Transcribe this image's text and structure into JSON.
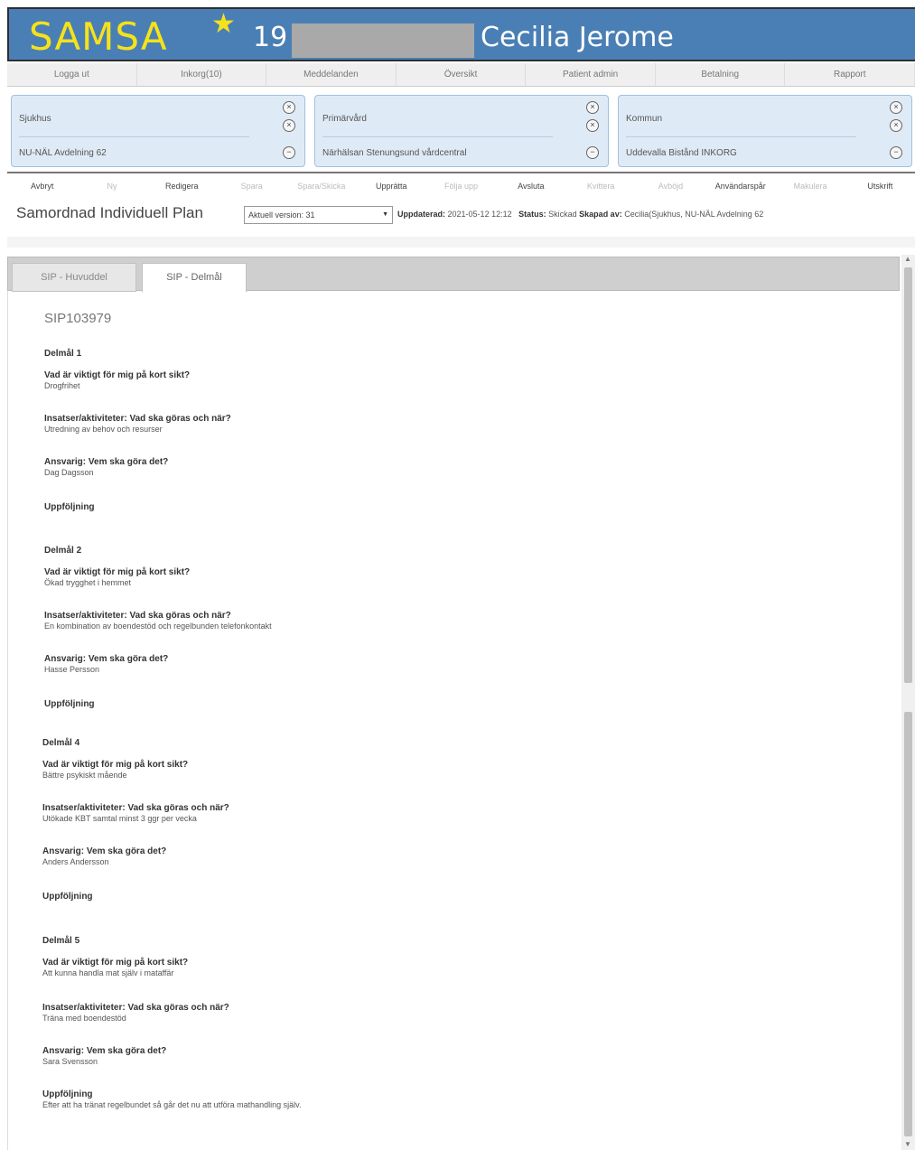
{
  "header": {
    "brand": "SAMSA",
    "star": "★",
    "patient_id_prefix": "19",
    "patient_name": "Cecilia Jerome"
  },
  "nav": [
    "Logga ut",
    "Inkorg(10)",
    "Meddelanden",
    "Översikt",
    "Patient admin",
    "Betalning",
    "Rapport"
  ],
  "care_boxes": [
    {
      "title": "Sjukhus",
      "unit": "NU-NÄL Avdelning 62"
    },
    {
      "title": "Primärvård",
      "unit": "Närhälsan Stenungsund vårdcentral"
    },
    {
      "title": "Kommun",
      "unit": "Uddevalla Bistånd INKORG"
    }
  ],
  "actions": [
    {
      "label": "Avbryt",
      "enabled": true
    },
    {
      "label": "Ny",
      "enabled": false
    },
    {
      "label": "Redigera",
      "enabled": true
    },
    {
      "label": "Spara",
      "enabled": false
    },
    {
      "label": "Spara/Skicka",
      "enabled": false
    },
    {
      "label": "Upprätta",
      "enabled": true
    },
    {
      "label": "Följa upp",
      "enabled": false
    },
    {
      "label": "Avsluta",
      "enabled": true
    },
    {
      "label": "Kvittera",
      "enabled": false
    },
    {
      "label": "Avböjd",
      "enabled": false
    },
    {
      "label": "Användarspår",
      "enabled": true
    },
    {
      "label": "Makulera",
      "enabled": false
    },
    {
      "label": "Utskrift",
      "enabled": true
    }
  ],
  "plan": {
    "title": "Samordnad Individuell Plan",
    "version": "Aktuell version: 31",
    "updated_label": "Uppdaterad:",
    "updated_value": "2021-05-12 12:12",
    "status_label": "Status:",
    "status_value": "Skickad",
    "created_label": "Skapad av:",
    "created_value": "Cecilia(Sjukhus, NU-NÄL Avdelning 62"
  },
  "tabs": [
    "SIP - Huvuddel",
    "SIP - Delmål"
  ],
  "sip_id": "SIP103979",
  "field_labels": {
    "short": "Vad är viktigt för mig på kort sikt?",
    "action": "Insatser/aktiviteter: Vad ska göras och när?",
    "resp": "Ansvarig: Vem ska göra det?",
    "follow": "Uppföljning"
  },
  "goals": [
    {
      "heading": "Delmål 1",
      "short": "Drogfrihet",
      "action": "Utredning av behov och resurser",
      "resp": "Dag Dagsson",
      "follow": ""
    },
    {
      "heading": "Delmål 2",
      "short": "Ökad trygghet i hemmet",
      "action": "En kombination av boendestöd och regelbunden telefonkontakt",
      "resp": "Hasse Persson",
      "follow": ""
    },
    {
      "heading": "Delmål 4",
      "short": "Bättre psykiskt mående",
      "action": "Utökade KBT samtal minst 3 ggr per vecka",
      "resp": "Anders Andersson",
      "follow": ""
    },
    {
      "heading": "Delmål 5",
      "short": "Att kunna handla mat själv i mataffär",
      "action": "Träna med boendestöd",
      "resp": "Sara Svensson",
      "follow": "Efter att ha tränat regelbundet så går det nu att utföra mathandling själv."
    }
  ]
}
